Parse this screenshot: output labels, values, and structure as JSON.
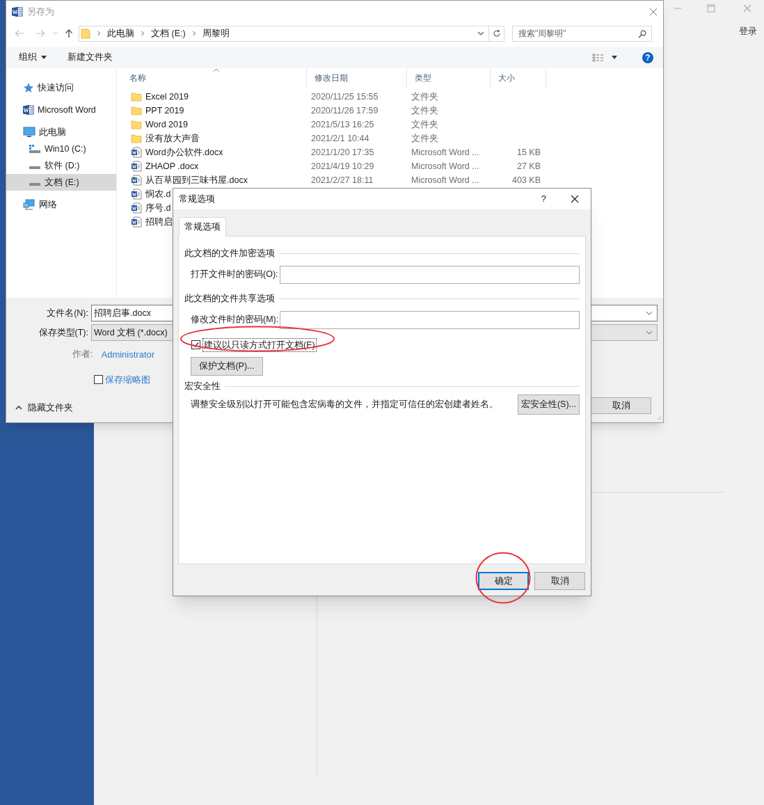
{
  "app": {
    "login": "登录"
  },
  "save_dialog": {
    "title": "另存为",
    "breadcrumb": [
      "此电脑",
      "文档 (E:)",
      "周黎明"
    ],
    "search": {
      "placeholder": "搜索\"周黎明\""
    },
    "toolbar": {
      "organize": "组织",
      "new_folder": "新建文件夹",
      "help": "?"
    },
    "columns": [
      "名称",
      "修改日期",
      "类型",
      "大小"
    ],
    "sidebar": [
      {
        "label": "快速访问",
        "kind": "star",
        "selected": false
      },
      {
        "label": "Microsoft Word",
        "kind": "word",
        "selected": false
      },
      {
        "label": "此电脑",
        "kind": "pc",
        "selected": false,
        "children": [
          {
            "label": "Win10 (C:)",
            "kind": "system-drive",
            "selected": false
          },
          {
            "label": "软件 (D:)",
            "kind": "drive",
            "selected": false
          },
          {
            "label": "文档 (E:)",
            "kind": "drive",
            "selected": true
          }
        ]
      },
      {
        "label": "网络",
        "kind": "network",
        "selected": false
      }
    ],
    "files": [
      {
        "name": "Excel 2019",
        "kind": "folder",
        "date": "2020/11/25 15:55",
        "type": "文件夹"
      },
      {
        "name": "PPT 2019",
        "kind": "folder",
        "date": "2020/11/26 17:59",
        "type": "文件夹"
      },
      {
        "name": "Word 2019",
        "kind": "folder",
        "date": "2021/5/13 16:25",
        "type": "文件夹"
      },
      {
        "name": "没有放大声音",
        "kind": "folder",
        "date": "2021/2/1 10:44",
        "type": "文件夹"
      },
      {
        "name": "Word办公软件.docx",
        "kind": "doc",
        "date": "2021/1/20 17:35",
        "type": "Microsoft Word ...",
        "size": "15 KB"
      },
      {
        "name": "ZHAOP .docx",
        "kind": "doc",
        "date": "2021/4/19 10:29",
        "type": "Microsoft Word ...",
        "size": "27 KB"
      },
      {
        "name": "从百草园到三味书屋.docx",
        "kind": "doc",
        "date": "2021/2/27 18:11",
        "type": "Microsoft Word ...",
        "size": "403 KB"
      },
      {
        "name": "悯农.d",
        "kind": "doc"
      },
      {
        "name": "序号.d",
        "kind": "doc"
      },
      {
        "name": "招聘启",
        "kind": "doc"
      }
    ],
    "file_name": {
      "label": "文件名(N):",
      "value": "招聘启事.docx"
    },
    "file_type": {
      "label": "保存类型(T):",
      "value": "Word 文档 (*.docx)"
    },
    "author": {
      "label": "作者:",
      "value": "Administrator"
    },
    "thumbnail": {
      "label": "保存缩略图",
      "checked": false
    },
    "hide_folders": "隐藏文件夹",
    "cancel": "取消"
  },
  "options_dialog": {
    "title": "常规选项",
    "help": "?",
    "tabs": [
      {
        "label": "常规选项",
        "selected": true
      }
    ],
    "encryption_heading": "此文档的文件加密选项",
    "open_password": {
      "label": "打开文件时的密码(O):"
    },
    "sharing_heading": "此文档的文件共享选项",
    "modify_password": {
      "label": "修改文件时的密码(M):"
    },
    "read_only": {
      "label": "建议以只读方式打开文档(E)",
      "checked": true
    },
    "protect_button": "保护文档(P)...",
    "macro_heading": "宏安全性",
    "macro_text": "调整安全级别以打开可能包含宏病毒的文件，并指定可信任的宏创建者姓名。",
    "macro_button": "宏安全性(S)...",
    "ok": "确定",
    "cancel": "取消"
  }
}
